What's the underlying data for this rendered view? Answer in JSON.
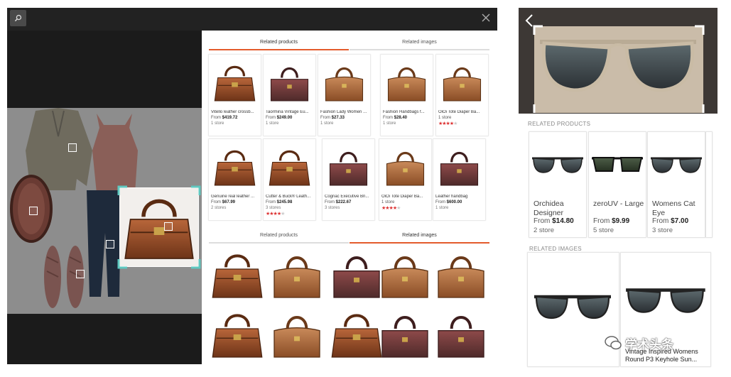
{
  "viewer": {
    "icons": {
      "search": "search-icon",
      "close": "close-icon"
    }
  },
  "results": {
    "top_tabs": [
      "Related products",
      "Related images"
    ],
    "top_active": 0,
    "bottom_tabs": [
      "Related products",
      "Related images"
    ],
    "bottom_active": 1,
    "products_row1": [
      {
        "name": "Vitello leather crossb...",
        "from": "From",
        "price": "$419.72",
        "stores": "1 store"
      },
      {
        "name": "Taormina Vintage Eu...",
        "from": "From",
        "price": "$249.00",
        "stores": "1 store"
      },
      {
        "name": "Fashion Lady Women Gi...",
        "from": "From",
        "price": "$27.33",
        "stores": "1 store"
      },
      {
        "name": "Fashion Handbags f...",
        "from": "From",
        "price": "$28.40",
        "stores": "1 store"
      },
      {
        "name": "OiOi Tote Diaper Ba...",
        "from": "",
        "price": "",
        "stores": "1 store",
        "rating": 3.5
      }
    ],
    "products_row2": [
      {
        "name": "Genuine real leather ...",
        "from": "From",
        "price": "$67.99",
        "stores": "2 stores"
      },
      {
        "name": "Cutter & Buck® Leath...",
        "from": "From",
        "price": "$245.98",
        "stores": "3 stores",
        "rating": 3.5
      },
      {
        "name": "Cognac Executive Bri...",
        "from": "From",
        "price": "$222.67",
        "stores": "3 stores"
      },
      {
        "name": "OiOi Tote Diaper Ba...",
        "from": "",
        "price": "",
        "stores": "1 store",
        "rating": 3.5
      },
      {
        "name": "Leather handbag",
        "from": "From",
        "price": "$600.00",
        "stores": "1 store"
      }
    ]
  },
  "mobile": {
    "related_products_label": "RELATED PRODUCTS",
    "related_images_label": "RELATED IMAGES",
    "products": [
      {
        "name": "Orchidea Designer",
        "from": "From",
        "price": "$14.80",
        "stores": "2 store"
      },
      {
        "name": "zeroUV - Large",
        "from": "From",
        "price": "$9.99",
        "stores": "5 store"
      },
      {
        "name": "Womens Cat Eye",
        "from": "From",
        "price": "$7.00",
        "stores": "3 store"
      }
    ],
    "image_caption": "Vintage Inspired Womens Round P3 Keyhole Sun...",
    "watermark": "学术头条"
  },
  "colors": {
    "accent": "#e35b2c",
    "star": "#d33333",
    "viewer_bg": "#1b1b1b",
    "selection": "#5fc8c0"
  }
}
